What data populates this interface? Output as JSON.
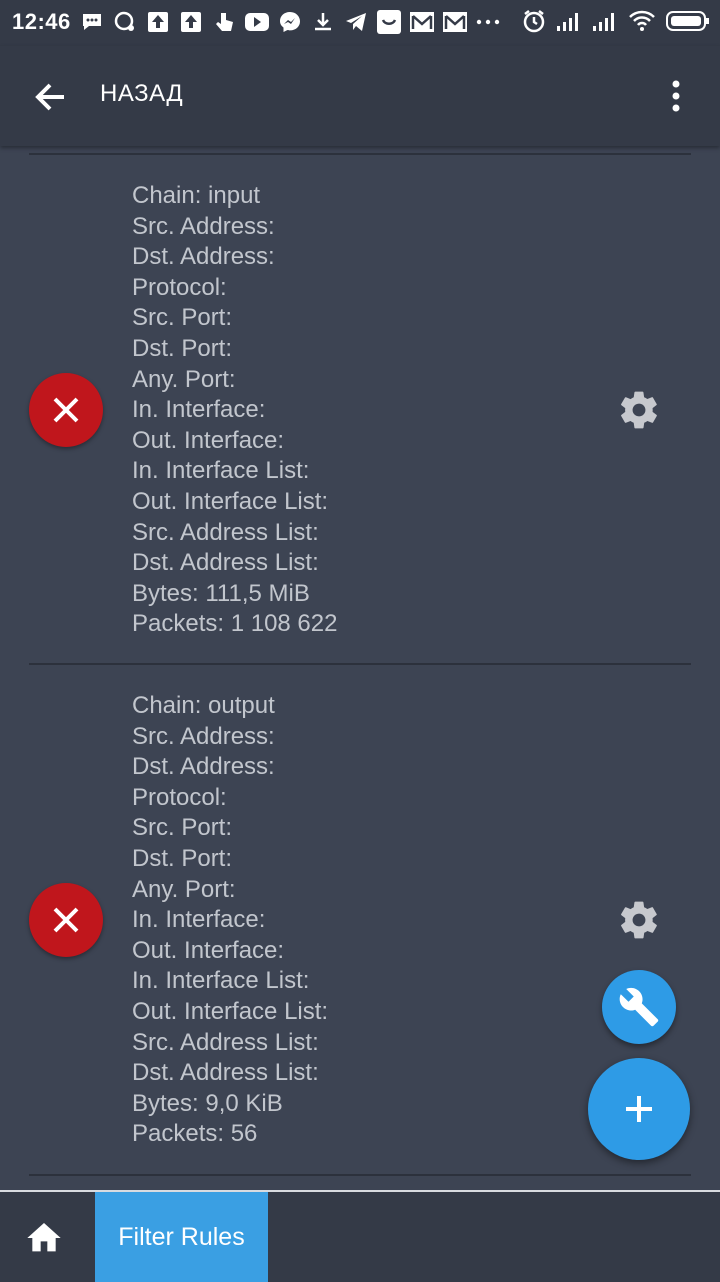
{
  "status_bar": {
    "time": "12:46",
    "icons": [
      "chat-icon",
      "assistant-icon",
      "upload-icon",
      "upload-icon",
      "touch-icon",
      "youtube-icon",
      "messenger-icon",
      "download-icon",
      "telegram-icon",
      "app-icon",
      "gmail-icon",
      "gmail-icon",
      "more-dots-icon",
      "alarm-icon",
      "signal-icon",
      "signal-icon",
      "wifi-icon",
      "battery-icon"
    ]
  },
  "app_bar": {
    "back_label": "НАЗАД",
    "back_icon": "arrow-back-icon",
    "menu_icon": "more-vert-icon"
  },
  "rules": [
    {
      "lines": [
        "Chain: input",
        "Src. Address:",
        "Dst. Address:",
        "Protocol:",
        "Src. Port:",
        "Dst. Port:",
        "Any. Port:",
        "In. Interface:",
        "Out. Interface:",
        "In. Interface List:",
        "Out. Interface List:",
        "Src. Address List:",
        "Dst. Address List:",
        "Bytes: 111,5 MiB",
        "Packets: 1 108 622"
      ]
    },
    {
      "lines": [
        "Chain: output",
        "Src. Address:",
        "Dst. Address:",
        "Protocol:",
        "Src. Port:",
        "Dst. Port:",
        "Any. Port:",
        "In. Interface:",
        "Out. Interface:",
        "In. Interface List:",
        "Out. Interface List:",
        "Src. Address List:",
        "Dst. Address List:",
        "Bytes: 9,0 KiB",
        "Packets: 56"
      ]
    }
  ],
  "fabs": {
    "tools_icon": "wrench-icon",
    "add_icon": "plus-icon"
  },
  "bottom_bar": {
    "home_icon": "home-icon",
    "active_tab_label": "Filter Rules"
  },
  "colors": {
    "background": "#3d4453",
    "app_bar": "#343a47",
    "delete_red": "#c0161c",
    "accent_blue": "#2e9be6"
  }
}
